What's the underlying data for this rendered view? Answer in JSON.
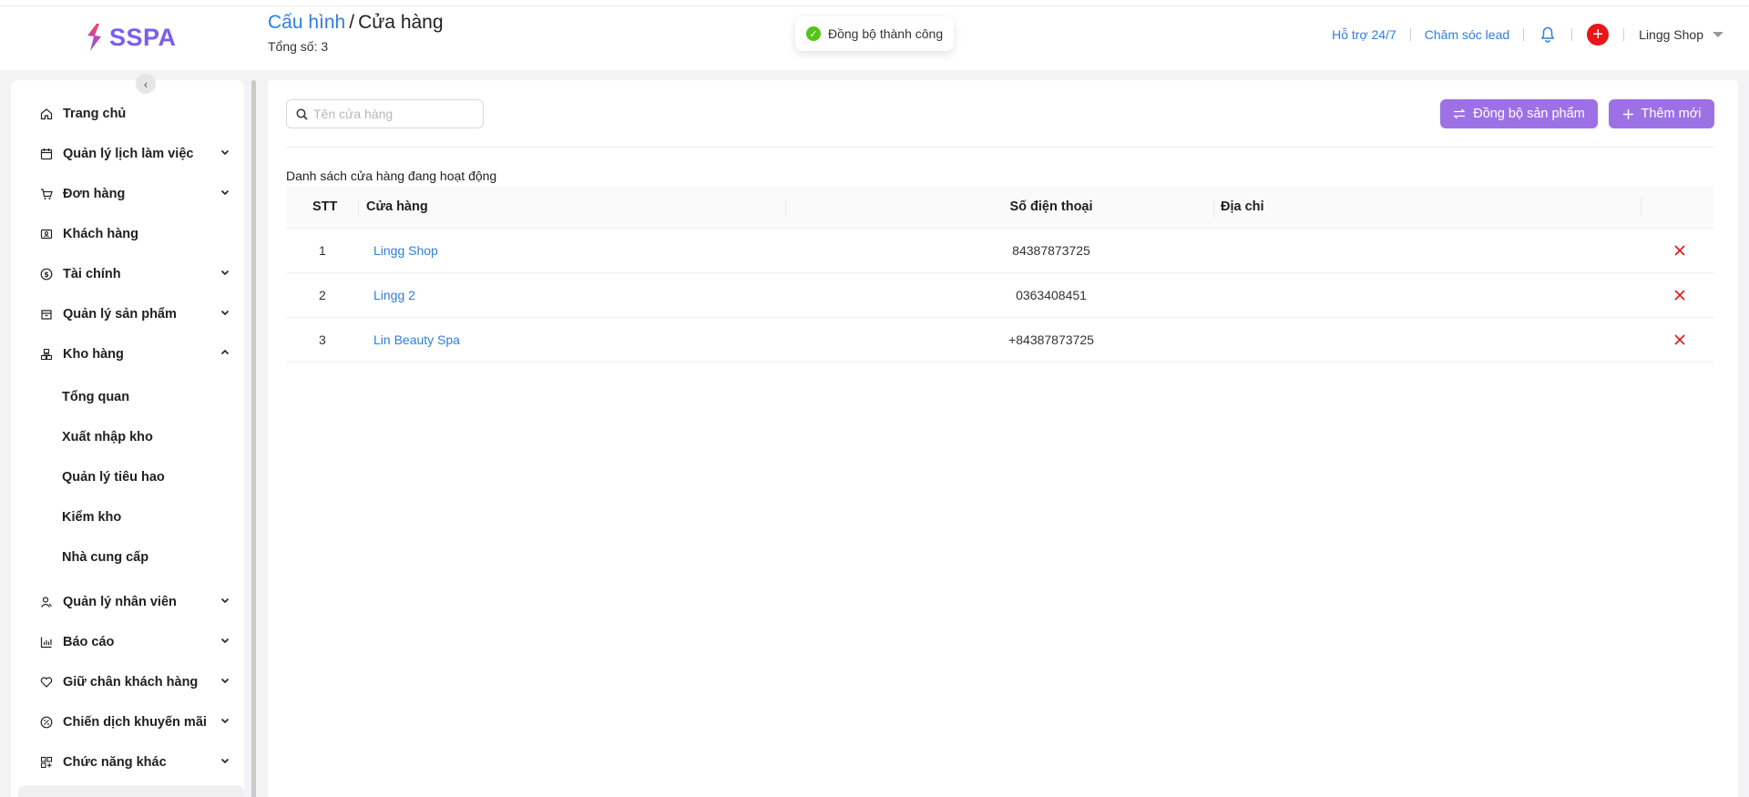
{
  "header": {
    "logo_text": "SSPA",
    "breadcrumb": {
      "parent": "Cấu hình",
      "separator": "/",
      "current": "Cửa hàng"
    },
    "total_text": "Tổng số: 3",
    "links": [
      "Hỗ trợ 24/7",
      "Chăm sóc lead"
    ],
    "user_name": "Lingg Shop"
  },
  "toast": {
    "message": "Đồng bộ thành công"
  },
  "sidebar": {
    "items": [
      {
        "label": "Trang chủ",
        "icon": "home-icon",
        "expandable": false
      },
      {
        "label": "Quản lý lịch làm việc",
        "icon": "calendar-icon",
        "expandable": true
      },
      {
        "label": "Đơn hàng",
        "icon": "cart-icon",
        "expandable": true
      },
      {
        "label": "Khách hàng",
        "icon": "customer-card-icon",
        "expandable": false
      },
      {
        "label": "Tài chính",
        "icon": "dollar-icon",
        "expandable": true
      },
      {
        "label": "Quản lý sản phẩm",
        "icon": "box-icon",
        "expandable": true
      },
      {
        "label": "Kho hàng",
        "icon": "warehouse-icon",
        "expanded": true
      },
      {
        "label": "Quản lý nhân viên",
        "icon": "staff-icon",
        "expandable": true
      },
      {
        "label": "Báo cáo",
        "icon": "chart-icon",
        "expandable": true
      },
      {
        "label": "Giữ chân khách hàng",
        "icon": "heart-icon",
        "expandable": true
      },
      {
        "label": "Chiến dịch khuyến mãi",
        "icon": "percent-icon",
        "expandable": true
      },
      {
        "label": "Chức năng khác",
        "icon": "grid-icon",
        "expandable": true
      }
    ],
    "sub_items": [
      "Tổng quan",
      "Xuất nhập kho",
      "Quản lý tiêu hao",
      "Kiểm kho",
      "Nhà cung cấp"
    ]
  },
  "toolbar": {
    "search_placeholder": "Tên cửa hàng",
    "sync_label": "Đồng bộ sản phẩm",
    "add_label": "Thêm mới"
  },
  "table": {
    "title": "Danh sách cửa hàng đang hoạt động",
    "columns": [
      "STT",
      "Cửa hàng",
      "Số điện thoại",
      "Địa chỉ"
    ],
    "rows": [
      {
        "stt": "1",
        "store": "Lingg Shop",
        "phone": "84387873725",
        "address": ""
      },
      {
        "stt": "2",
        "store": "Lingg 2",
        "phone": "0363408451",
        "address": ""
      },
      {
        "stt": "3",
        "store": "Lin Beauty Spa",
        "phone": "+84387873725",
        "address": ""
      }
    ]
  },
  "colors": {
    "brand": "#7b5cf0",
    "primary_button": "#9d71e5",
    "link": "#2f7de1",
    "danger": "#e7161b",
    "success": "#52c41a"
  }
}
